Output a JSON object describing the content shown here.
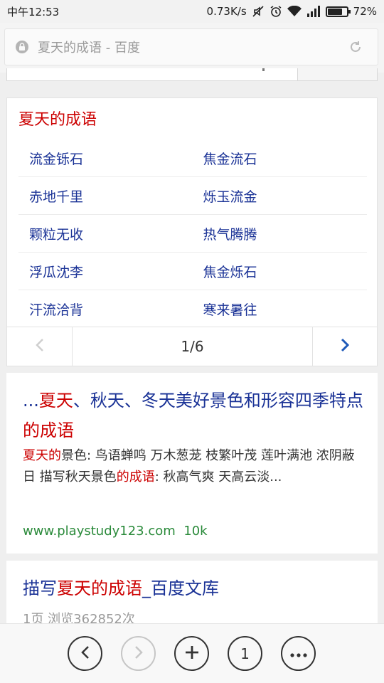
{
  "status_bar": {
    "time": "中午12:53",
    "speed": "0.73K/s",
    "battery": "72%",
    "battery_level": 0.72
  },
  "address_bar": {
    "title": "夏天的成语 - 百度",
    "lock_icon": "lock-icon",
    "refresh_icon": "refresh-icon"
  },
  "idiom_card": {
    "title": "夏天的成语",
    "rows": [
      [
        "流金铄石",
        "焦金流石"
      ],
      [
        "赤地千里",
        "烁玉流金"
      ],
      [
        "颗粒无收",
        "热气腾腾"
      ],
      [
        "浮瓜沈李",
        "焦金烁石"
      ],
      [
        "汗流洽背",
        "寒来暑往"
      ]
    ],
    "pager": {
      "current": "1",
      "sep": "/",
      "total": "6"
    }
  },
  "result1": {
    "title_prefix": "...",
    "title_hl1": "夏天",
    "title_mid": "、秋天、冬天美好景色和形容四季特点",
    "title_hl2": "的成语",
    "snippet_hl1": "夏天的",
    "snippet_part1": "景色: 鸟语蝉鸣 万木葱茏 枝繁叶茂 莲叶满池 浓阴蔽日 描写秋天景色",
    "snippet_hl2": "的成语",
    "snippet_part2": ": 秋高气爽 天高云淡...",
    "url": "www.playstudy123.com",
    "size": "10k"
  },
  "result2": {
    "title_prefix": "描写",
    "title_hl": "夏天的成语",
    "title_suffix": "_百度文库",
    "meta": "1页 浏览362852次"
  },
  "toolbar": {
    "tab_count": "1"
  },
  "colors": {
    "link": "#1a3296",
    "highlight": "#cc0000",
    "url_green": "#2a8a3a"
  }
}
